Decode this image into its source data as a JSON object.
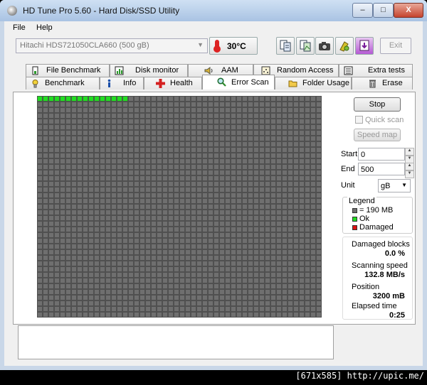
{
  "window": {
    "title": "HD Tune Pro 5.60 - Hard Disk/SSD Utility",
    "controls": {
      "minimize": "–",
      "maximize": "□",
      "close": "X"
    }
  },
  "menu": {
    "file": "File",
    "help": "Help"
  },
  "toolbar": {
    "drive": "Hitachi HDS721050CLA660 (500 gB)",
    "temperature": "30°C",
    "exit_label": "Exit",
    "icons": [
      "copy-text-icon",
      "copy-image-icon",
      "screenshot-icon",
      "options-icon",
      "save-icon"
    ]
  },
  "tabs_top": [
    "File Benchmark",
    "Disk monitor",
    "AAM",
    "Random Access",
    "Extra tests"
  ],
  "tabs_bottom": [
    "Benchmark",
    "Info",
    "Health",
    "Error Scan",
    "Folder Usage",
    "Erase"
  ],
  "active_tab": "Error Scan",
  "scan": {
    "stop_label": "Stop",
    "quick_scan_label": "Quick scan",
    "quick_scan_checked": false,
    "speed_map_label": "Speed map",
    "start_label": "Start",
    "start_value": "0",
    "end_label": "End",
    "end_value": "500",
    "unit_label": "Unit",
    "unit_value": "gB",
    "ok_blocks_scanned": 16
  },
  "legend": {
    "title": "Legend",
    "block_size": "= 190 MB",
    "ok": "Ok",
    "damaged": "Damaged",
    "colors": {
      "block": "#6f6f6f",
      "ok": "#22dd22",
      "damaged": "#dd1111"
    }
  },
  "stats": {
    "damaged_label": "Damaged blocks",
    "damaged_value": "0.0 %",
    "speed_label": "Scanning speed",
    "speed_value": "132.8 MB/s",
    "position_label": "Position",
    "position_value": "3200 mB",
    "elapsed_label": "Elapsed time",
    "elapsed_value": "0:25"
  },
  "watermark": "[671x585] http://upic.me/"
}
